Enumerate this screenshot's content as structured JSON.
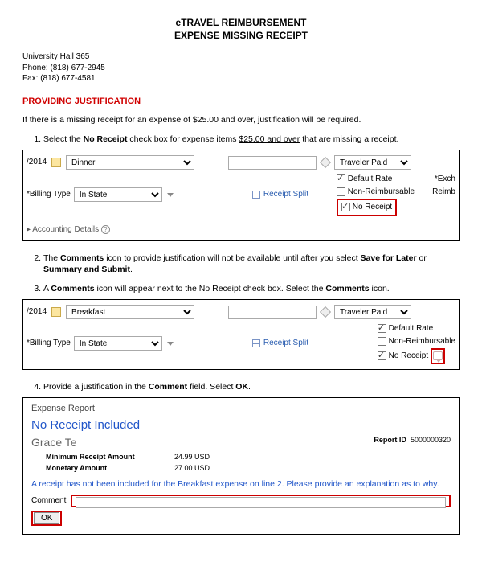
{
  "header": {
    "title": "eTRAVEL REIMBURSEMENT",
    "subtitle": "EXPENSE MISSING RECEIPT",
    "address": "University Hall 365",
    "phone": "Phone: (818) 677-2945",
    "fax": "Fax: (818) 677-4581"
  },
  "section_head": "PROVIDING JUSTIFICATION",
  "intro": "If there is a missing receipt for an expense of $25.00 and over, justification will be required.",
  "steps": {
    "s1a": "Select the ",
    "s1b": "No Receipt",
    "s1c": " check box for expense items ",
    "s1d": "$25.00 and over",
    "s1e": " that are missing a receipt.",
    "s2a": "The ",
    "s2b": "Comments",
    "s2c": " icon to provide justification will not be available until after you select ",
    "s2d": "Save for Later",
    "s2e": " or ",
    "s2f": "Summary and Submit",
    "s2g": ".",
    "s3a": "A ",
    "s3b": "Comments",
    "s3c": " icon will appear next to the No Receipt check box. Select the ",
    "s3d": "Comments",
    "s3e": " icon.",
    "s4a": "Provide a justification in the ",
    "s4b": "Comment",
    "s4c": " field. Select ",
    "s4d": "OK",
    "s4e": "."
  },
  "shot1": {
    "date_frag": "/2014",
    "expense_type": "Dinner",
    "billing_label": "*Billing Type",
    "billing_value": "In State",
    "receipt_split": "Receipt Split",
    "payment": "Traveler Paid",
    "opt_default": "Default Rate",
    "opt_nonreimb": "Non-Reimbursable",
    "opt_noreceipt": "No Receipt",
    "trail_exch": "*Exch",
    "trail_reimb": "Reimb",
    "acct": "Accounting Details"
  },
  "shot2": {
    "date_frag": "/2014",
    "expense_type": "Breakfast",
    "billing_label": "*Billing Type",
    "billing_value": "In State",
    "receipt_split": "Receipt Split",
    "payment": "Traveler Paid",
    "opt_default": "Default Rate",
    "opt_nonreimb": "Non-Reimbursable",
    "opt_noreceipt": "No Receipt"
  },
  "report": {
    "header": "Expense Report",
    "title": "No Receipt Included",
    "person": "Grace Te",
    "report_id_lab": "Report ID",
    "report_id_val": "5000000320",
    "min_lab": "Minimum Receipt Amount",
    "min_val": "24.99   USD",
    "mon_lab": "Monetary Amount",
    "mon_val": "27.00   USD",
    "note": "A receipt has not been included for the Breakfast expense on line 2. Please provide an explanation as to why.",
    "comment_lab": "Comment",
    "ok": "OK"
  }
}
